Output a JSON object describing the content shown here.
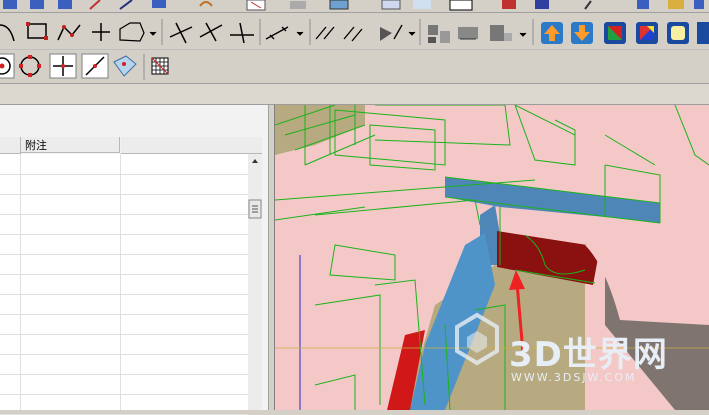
{
  "toolbar_top": {
    "icons": [
      "solid-icon",
      "solid-icon",
      "solid-icon",
      "edit-icon",
      "line-icon",
      "surface-icon",
      "arc-icon",
      "grid-icon",
      "box-icon",
      "cube-icon",
      "color-icon",
      "plane-icon",
      "view-icon",
      "cursor-icon",
      "sheet-icon",
      "pen-icon"
    ]
  },
  "toolbar_sketch": {
    "icons": [
      "arc-tool-icon",
      "rectangle-tool-icon",
      "polyline-tool-icon",
      "point-tool-icon",
      "fillet-tool-icon",
      "trim-tool-icon",
      "trim2-tool-icon",
      "extend-tool-icon",
      "dimension-tool-icon",
      "constraint-tool-icon",
      "offset-tool-icon",
      "component-tool-icon",
      "machine-tool-icon",
      "stamp-tool-icon",
      "arrow-up-icon",
      "arrow-down-icon",
      "shade-icon",
      "color-map-icon",
      "display-icon"
    ]
  },
  "toolbar_snap": {
    "icons": [
      "snap-center-icon",
      "snap-circle-icon",
      "snap-cross-icon",
      "snap-line-icon",
      "snap-surface-icon",
      "mesh-grid-icon"
    ]
  },
  "table": {
    "column_note": "附注",
    "rows": 13
  },
  "viewport": {
    "watermark_title": "3D世界网",
    "watermark_url": "WWW.3DSJW.COM"
  },
  "colors": {
    "background": "#d4d0c8",
    "viewport_bg": "#f5c8c8",
    "wireframe": "#1bb31b",
    "solid_blue": "#4f86b8",
    "solid_red": "#8b1010",
    "solid_tan": "#b8aa80",
    "annotation_arrow": "#ee2222"
  }
}
